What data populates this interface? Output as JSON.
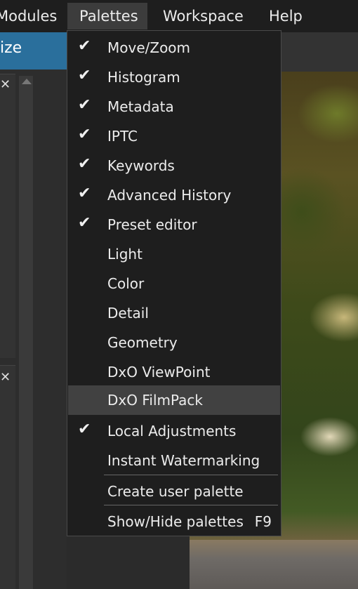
{
  "menubar": {
    "items": [
      {
        "label": "Modules"
      },
      {
        "label": "Palettes",
        "active": true
      },
      {
        "label": "Workspace"
      },
      {
        "label": "Help"
      }
    ]
  },
  "left": {
    "tab_label": "ize",
    "close_glyph": "✕"
  },
  "palettes_menu": {
    "items": [
      {
        "label": "Move/Zoom",
        "checked": true
      },
      {
        "label": "Histogram",
        "checked": true
      },
      {
        "label": "Metadata",
        "checked": true
      },
      {
        "label": "IPTC",
        "checked": true
      },
      {
        "label": "Keywords",
        "checked": true
      },
      {
        "label": "Advanced History",
        "checked": true
      },
      {
        "label": "Preset editor",
        "checked": true
      },
      {
        "label": "Light",
        "checked": false
      },
      {
        "label": "Color",
        "checked": false
      },
      {
        "label": "Detail",
        "checked": false
      },
      {
        "label": "Geometry",
        "checked": false
      },
      {
        "label": "DxO ViewPoint",
        "checked": false
      },
      {
        "label": "DxO FilmPack",
        "checked": false,
        "highlighted": true
      },
      {
        "label": "Local Adjustments",
        "checked": true
      },
      {
        "label": "Instant Watermarking",
        "checked": false
      },
      {
        "label": "Create user palette",
        "checked": false
      },
      {
        "label": "Show/Hide palettes",
        "checked": false,
        "shortcut": "F9"
      }
    ],
    "check_glyph": "✔"
  },
  "colors": {
    "accent": "#2a6f9c",
    "menu_bg": "#1e1e1e",
    "highlight": "#414141"
  }
}
